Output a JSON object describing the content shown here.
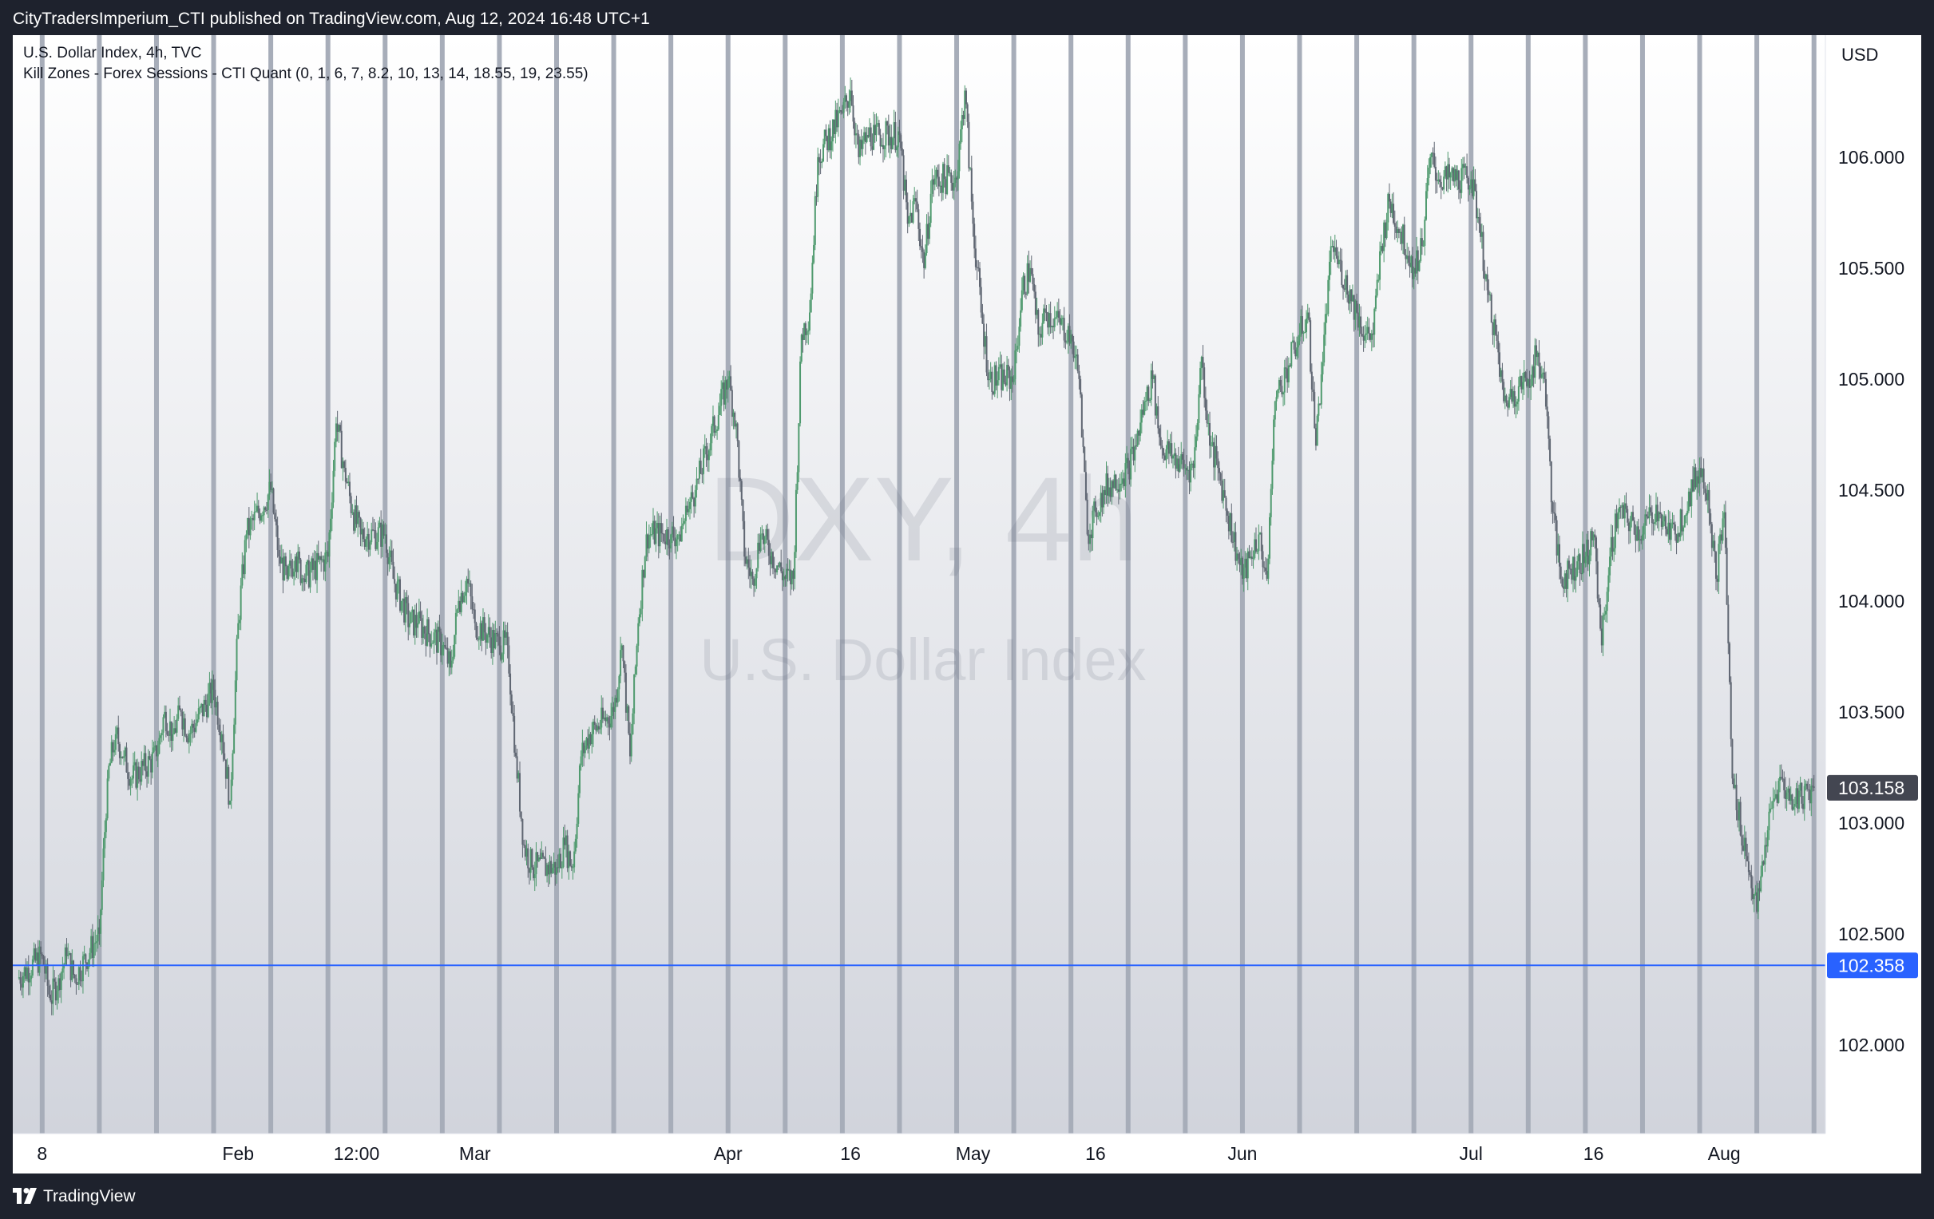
{
  "header": {
    "publish_line": "CityTradersImperium_CTI published on TradingView.com, Aug 12, 2024 16:48 UTC+1"
  },
  "legend": {
    "symbol_line": "U.S. Dollar Index, 4h, TVC",
    "indicator_line": "Kill Zones - Forex Sessions - CTI Quant (0, 1, 6, 7, 8.2, 10, 13, 14, 18.55, 19, 23.55)"
  },
  "watermark": {
    "symbol": "DXY, 4h",
    "name": "U.S. Dollar Index"
  },
  "footer": {
    "brand": "TradingView",
    "logo_icon": "tradingview-logo-icon"
  },
  "colors": {
    "page_bg": "#1e222d",
    "candle": "#5f6672",
    "candle_up": "#4f9a6e",
    "session_line": "#a7adb9",
    "support_line": "#2962ff",
    "last_price_label": "#434651",
    "support_label": "#2962ff"
  },
  "chart_data": {
    "type": "candlestick",
    "currency": "USD",
    "ylim": [
      101.6,
      106.55
    ],
    "y_ticks": [
      "102.000",
      "102.500",
      "103.000",
      "103.500",
      "104.000",
      "104.500",
      "105.000",
      "105.500",
      "106.000"
    ],
    "x_ticks": [
      "8",
      "Feb",
      "12:00",
      "Mar",
      "Apr",
      "16",
      "May",
      "16",
      "Jun",
      "Jul",
      "16",
      "Aug"
    ],
    "last_price": "103.158",
    "horizontal_line": {
      "value": 102.358,
      "label": "102.358"
    },
    "session_markers": "weekly",
    "series": [
      {
        "values": [
          {
            "x": "Jan 5",
            "y": 102.3
          },
          {
            "x": "Jan 8",
            "y": 102.4
          },
          {
            "x": "Jan 9",
            "y": 102.2
          },
          {
            "x": "Jan 10",
            "y": 102.3
          },
          {
            "x": "Jan 11",
            "y": 102.4
          },
          {
            "x": "Jan 12",
            "y": 102.3
          },
          {
            "x": "Jan 15",
            "y": 102.5
          },
          {
            "x": "Jan 16",
            "y": 103.2
          },
          {
            "x": "Jan 17",
            "y": 103.4
          },
          {
            "x": "Jan 18",
            "y": 103.3
          },
          {
            "x": "Jan 19",
            "y": 103.2
          },
          {
            "x": "Jan 22",
            "y": 103.3
          },
          {
            "x": "Jan 23",
            "y": 103.5
          },
          {
            "x": "Jan 24",
            "y": 103.4
          },
          {
            "x": "Jan 25",
            "y": 103.5
          },
          {
            "x": "Jan 26",
            "y": 103.4
          },
          {
            "x": "Jan 29",
            "y": 103.6
          },
          {
            "x": "Jan 30",
            "y": 103.4
          },
          {
            "x": "Jan 31",
            "y": 103.1
          },
          {
            "x": "Feb 1",
            "y": 103.9
          },
          {
            "x": "Feb 2",
            "y": 104.3
          },
          {
            "x": "Feb 5",
            "y": 104.5
          },
          {
            "x": "Feb 6",
            "y": 104.2
          },
          {
            "x": "Feb 7",
            "y": 104.1
          },
          {
            "x": "Feb 8",
            "y": 104.2
          },
          {
            "x": "Feb 9",
            "y": 104.1
          },
          {
            "x": "Feb 12",
            "y": 104.2
          },
          {
            "x": "Feb 13",
            "y": 104.8
          },
          {
            "x": "Feb 14",
            "y": 104.6
          },
          {
            "x": "Feb 15",
            "y": 104.4
          },
          {
            "x": "Feb 16",
            "y": 104.3
          },
          {
            "x": "Feb 19",
            "y": 104.3
          },
          {
            "x": "Feb 20",
            "y": 104.1
          },
          {
            "x": "Feb 21",
            "y": 104.0
          },
          {
            "x": "Feb 22",
            "y": 103.9
          },
          {
            "x": "Feb 23",
            "y": 103.9
          },
          {
            "x": "Feb 26",
            "y": 103.8
          },
          {
            "x": "Feb 27",
            "y": 103.7
          },
          {
            "x": "Feb 28",
            "y": 104.0
          },
          {
            "x": "Feb 29",
            "y": 104.1
          },
          {
            "x": "Mar 1",
            "y": 103.9
          },
          {
            "x": "Mar 4",
            "y": 103.8
          },
          {
            "x": "Mar 5",
            "y": 103.8
          },
          {
            "x": "Mar 6",
            "y": 103.3
          },
          {
            "x": "Mar 7",
            "y": 102.9
          },
          {
            "x": "Mar 8",
            "y": 102.8
          },
          {
            "x": "Mar 11",
            "y": 102.8
          },
          {
            "x": "Mar 12",
            "y": 102.9
          },
          {
            "x": "Mar 13",
            "y": 102.8
          },
          {
            "x": "Mar 14",
            "y": 103.3
          },
          {
            "x": "Mar 15",
            "y": 103.4
          },
          {
            "x": "Mar 18",
            "y": 103.5
          },
          {
            "x": "Mar 19",
            "y": 103.8
          },
          {
            "x": "Mar 20",
            "y": 103.3
          },
          {
            "x": "Mar 21",
            "y": 103.9
          },
          {
            "x": "Mar 22",
            "y": 104.3
          },
          {
            "x": "Mar 25",
            "y": 104.3
          },
          {
            "x": "Mar 26",
            "y": 104.3
          },
          {
            "x": "Mar 27",
            "y": 104.4
          },
          {
            "x": "Mar 28",
            "y": 104.5
          },
          {
            "x": "Apr 1",
            "y": 105.0
          },
          {
            "x": "Apr 2",
            "y": 104.8
          },
          {
            "x": "Apr 3",
            "y": 104.2
          },
          {
            "x": "Apr 4",
            "y": 104.1
          },
          {
            "x": "Apr 5",
            "y": 104.3
          },
          {
            "x": "Apr 8",
            "y": 104.1
          },
          {
            "x": "Apr 9",
            "y": 104.1
          },
          {
            "x": "Apr 10",
            "y": 105.2
          },
          {
            "x": "Apr 11",
            "y": 105.3
          },
          {
            "x": "Apr 12",
            "y": 106.0
          },
          {
            "x": "Apr 15",
            "y": 106.2
          },
          {
            "x": "Apr 16",
            "y": 106.3
          },
          {
            "x": "Apr 17",
            "y": 106.0
          },
          {
            "x": "Apr 18",
            "y": 106.1
          },
          {
            "x": "Apr 19",
            "y": 106.1
          },
          {
            "x": "Apr 22",
            "y": 106.1
          },
          {
            "x": "Apr 23",
            "y": 105.7
          },
          {
            "x": "Apr 24",
            "y": 105.8
          },
          {
            "x": "Apr 25",
            "y": 105.5
          },
          {
            "x": "Apr 26",
            "y": 105.9
          },
          {
            "x": "Apr 29",
            "y": 105.9
          },
          {
            "x": "Apr 30",
            "y": 106.3
          },
          {
            "x": "May 1",
            "y": 105.7
          },
          {
            "x": "May 2",
            "y": 105.3
          },
          {
            "x": "May 3",
            "y": 105.0
          },
          {
            "x": "May 6",
            "y": 105.0
          },
          {
            "x": "May 7",
            "y": 105.4
          },
          {
            "x": "May 8",
            "y": 105.5
          },
          {
            "x": "May 9",
            "y": 105.2
          },
          {
            "x": "May 10",
            "y": 105.3
          },
          {
            "x": "May 13",
            "y": 105.2
          },
          {
            "x": "May 14",
            "y": 105.0
          },
          {
            "x": "May 15",
            "y": 104.3
          },
          {
            "x": "May 16",
            "y": 104.4
          },
          {
            "x": "May 17",
            "y": 104.5
          },
          {
            "x": "May 20",
            "y": 104.6
          },
          {
            "x": "May 21",
            "y": 104.7
          },
          {
            "x": "May 22",
            "y": 104.9
          },
          {
            "x": "May 23",
            "y": 105.0
          },
          {
            "x": "May 24",
            "y": 104.7
          },
          {
            "x": "May 27",
            "y": 104.6
          },
          {
            "x": "May 28",
            "y": 104.6
          },
          {
            "x": "May 29",
            "y": 105.1
          },
          {
            "x": "May 30",
            "y": 104.7
          },
          {
            "x": "May 31",
            "y": 104.6
          },
          {
            "x": "Jun 3",
            "y": 104.1
          },
          {
            "x": "Jun 4",
            "y": 104.2
          },
          {
            "x": "Jun 5",
            "y": 104.3
          },
          {
            "x": "Jun 6",
            "y": 104.1
          },
          {
            "x": "Jun 7",
            "y": 104.9
          },
          {
            "x": "Jun 10",
            "y": 105.2
          },
          {
            "x": "Jun 11",
            "y": 105.3
          },
          {
            "x": "Jun 12",
            "y": 104.7
          },
          {
            "x": "Jun 13",
            "y": 105.2
          },
          {
            "x": "Jun 14",
            "y": 105.6
          },
          {
            "x": "Jun 17",
            "y": 105.3
          },
          {
            "x": "Jun 18",
            "y": 105.2
          },
          {
            "x": "Jun 19",
            "y": 105.2
          },
          {
            "x": "Jun 20",
            "y": 105.6
          },
          {
            "x": "Jun 21",
            "y": 105.8
          },
          {
            "x": "Jun 24",
            "y": 105.5
          },
          {
            "x": "Jun 25",
            "y": 105.6
          },
          {
            "x": "Jun 26",
            "y": 106.0
          },
          {
            "x": "Jun 27",
            "y": 105.9
          },
          {
            "x": "Jun 28",
            "y": 105.9
          },
          {
            "x": "Jul 1",
            "y": 105.9
          },
          {
            "x": "Jul 2",
            "y": 105.7
          },
          {
            "x": "Jul 3",
            "y": 105.4
          },
          {
            "x": "Jul 4",
            "y": 105.2
          },
          {
            "x": "Jul 5",
            "y": 104.9
          },
          {
            "x": "Jul 8",
            "y": 105.0
          },
          {
            "x": "Jul 9",
            "y": 105.1
          },
          {
            "x": "Jul 10",
            "y": 105.0
          },
          {
            "x": "Jul 11",
            "y": 104.4
          },
          {
            "x": "Jul 12",
            "y": 104.1
          },
          {
            "x": "Jul 15",
            "y": 104.2
          },
          {
            "x": "Jul 16",
            "y": 104.3
          },
          {
            "x": "Jul 17",
            "y": 103.8
          },
          {
            "x": "Jul 18",
            "y": 104.2
          },
          {
            "x": "Jul 19",
            "y": 104.4
          },
          {
            "x": "Jul 22",
            "y": 104.3
          },
          {
            "x": "Jul 23",
            "y": 104.4
          },
          {
            "x": "Jul 24",
            "y": 104.4
          },
          {
            "x": "Jul 25",
            "y": 104.3
          },
          {
            "x": "Jul 26",
            "y": 104.3
          },
          {
            "x": "Jul 29",
            "y": 104.6
          },
          {
            "x": "Jul 30",
            "y": 104.5
          },
          {
            "x": "Jul 31",
            "y": 104.1
          },
          {
            "x": "Aug 1",
            "y": 104.4
          },
          {
            "x": "Aug 2",
            "y": 103.2
          },
          {
            "x": "Aug 5",
            "y": 102.6
          },
          {
            "x": "Aug 6",
            "y": 102.9
          },
          {
            "x": "Aug 7",
            "y": 103.1
          },
          {
            "x": "Aug 8",
            "y": 103.2
          },
          {
            "x": "Aug 9",
            "y": 103.1
          },
          {
            "x": "Aug 12",
            "y": 103.158
          }
        ]
      }
    ]
  }
}
